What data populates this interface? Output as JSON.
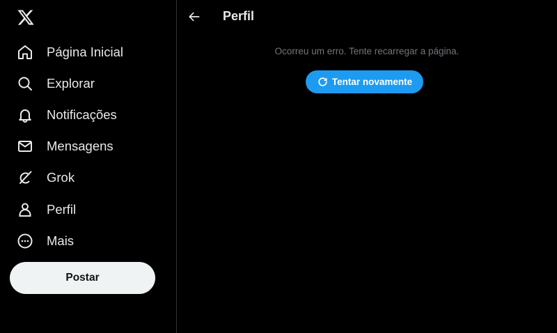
{
  "sidebar": {
    "logo_icon": "x-logo-icon",
    "items": [
      {
        "label": "Página Inicial",
        "icon": "home-icon"
      },
      {
        "label": "Explorar",
        "icon": "search-icon"
      },
      {
        "label": "Notificações",
        "icon": "bell-icon"
      },
      {
        "label": "Mensagens",
        "icon": "envelope-icon"
      },
      {
        "label": "Grok",
        "icon": "grok-icon"
      },
      {
        "label": "Perfil",
        "icon": "person-icon"
      },
      {
        "label": "Mais",
        "icon": "more-circle-icon"
      }
    ],
    "post_label": "Postar"
  },
  "header": {
    "back_icon": "arrow-left-icon",
    "title": "Perfil"
  },
  "main": {
    "error_message": "Ocorreu um erro. Tente recarregar a página.",
    "retry_label": "Tentar novamente",
    "retry_icon": "refresh-icon"
  },
  "colors": {
    "background": "#000000",
    "text": "#e7e9ea",
    "muted": "#71767b",
    "accent": "#1d9bf0",
    "divider": "#2f3336",
    "post_button_bg": "#eff3f4"
  }
}
